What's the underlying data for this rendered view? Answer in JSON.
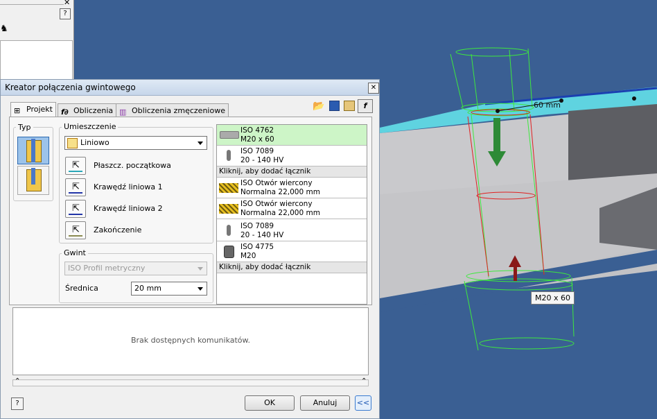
{
  "viewport": {
    "dimension_label": "60 mm",
    "tooltip": "M20 x 60"
  },
  "side_panel": {
    "close_icon": "close-icon",
    "help_icon": "help-icon"
  },
  "dialog": {
    "title": "Kreator połączenia gwintowego",
    "tabs": [
      {
        "label": "Projekt",
        "icon": "design-icon"
      },
      {
        "label": "Obliczenia",
        "icon": "fx-icon"
      },
      {
        "label": "Obliczenia zmęczeniowe",
        "icon": "fatigue-chart-icon"
      }
    ],
    "typ_label": "Typ",
    "placement": {
      "legend": "Umieszczenie",
      "value": "Liniowo",
      "commands": [
        "Płaszcz. początkowa",
        "Krawędź liniowa 1",
        "Krawędź liniowa 2",
        "Zakończenie"
      ]
    },
    "thread": {
      "legend": "Gwint",
      "profile_value": "ISO Profil metryczny",
      "diameter_label": "Średnica",
      "diameter_value": "20 mm"
    },
    "fasteners": [
      {
        "l1": "ISO 4762",
        "l2": "M20 x 60",
        "icon": "bolt-icon",
        "selected": true
      },
      {
        "l1": "ISO 7089",
        "l2": "20 - 140 HV",
        "icon": "washer-icon"
      },
      {
        "add": "Kliknij, aby dodać łącznik"
      },
      {
        "l1": "ISO Otwór wiercony",
        "l2": "Normalna 22,000 mm",
        "icon": "hole-icon"
      },
      {
        "l1": "ISO Otwór wiercony",
        "l2": "Normalna 22,000 mm",
        "icon": "hole-icon"
      },
      {
        "l1": "ISO 7089",
        "l2": "20 - 140 HV",
        "icon": "washer-icon"
      },
      {
        "l1": "ISO 4775",
        "l2": "M20",
        "icon": "nut-icon"
      },
      {
        "add": "Kliknij, aby dodać łącznik"
      }
    ],
    "messages": "Brak dostępnych komunikatów.",
    "buttons": {
      "ok": "OK",
      "cancel": "Anuluj",
      "collapse": "<<"
    }
  }
}
